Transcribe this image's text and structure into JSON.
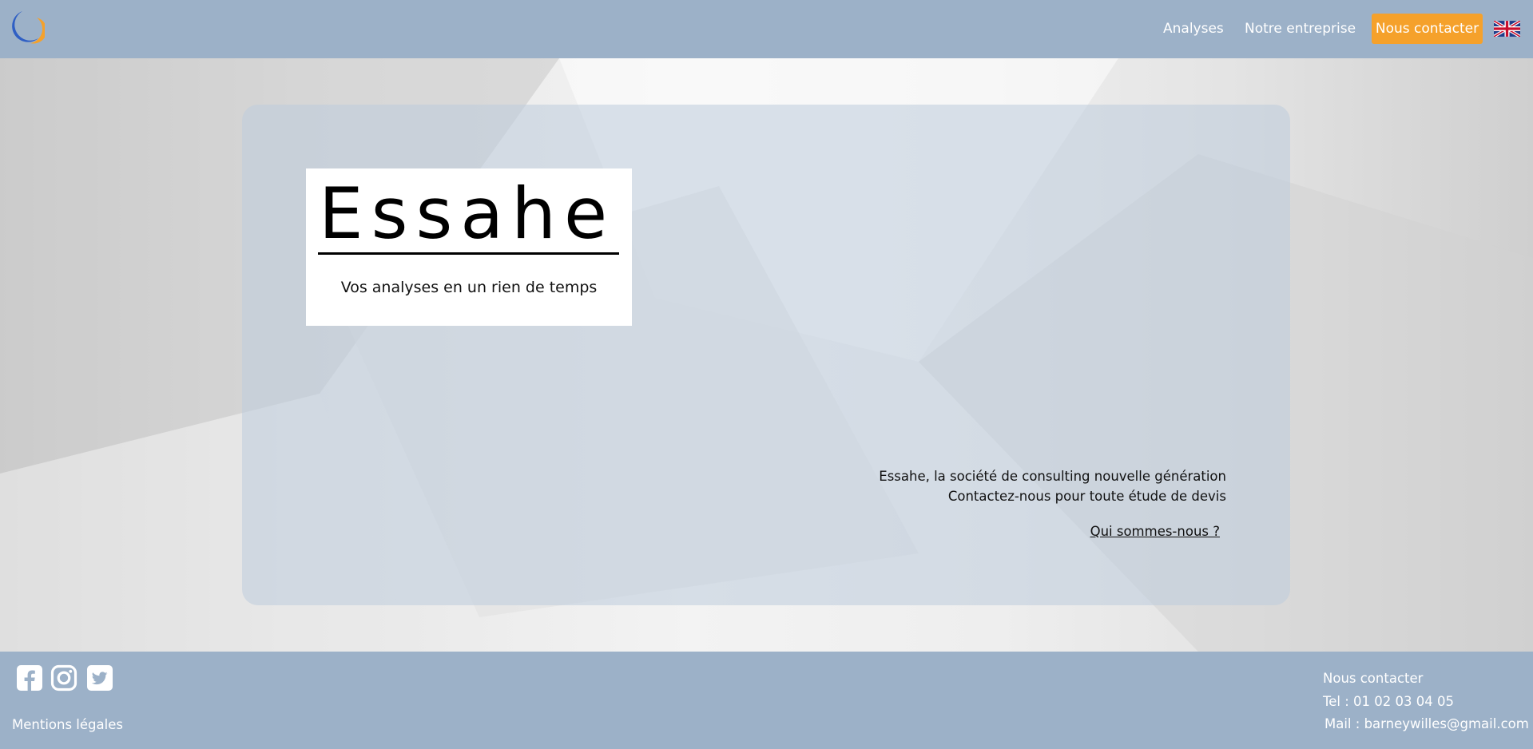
{
  "header": {
    "nav": {
      "analyses": "Analyses",
      "entreprise": "Notre entreprise",
      "contact": "Nous contacter"
    },
    "accent_color": "#f5a12b",
    "bar_color": "#9cb1c8",
    "logo_icon": "crescent-logo-icon",
    "language_icon": "uk-flag-icon"
  },
  "hero": {
    "brand_title": "Essahe",
    "tagline": "Vos analyses en un rien de temps",
    "intro_line1": "Essahe, la société de consulting nouvelle génération",
    "intro_line2": "Contactez-nous pour toute étude de devis",
    "about_link": "Qui sommes-nous ?"
  },
  "footer": {
    "social_icons": [
      "facebook-icon",
      "instagram-icon",
      "twitter-icon"
    ],
    "legal": "Mentions légales",
    "contact_title": "Nous contacter",
    "phone": "Tel : 01 02 03 04 05",
    "mail": "Mail : barneywilles@gmail.com"
  }
}
